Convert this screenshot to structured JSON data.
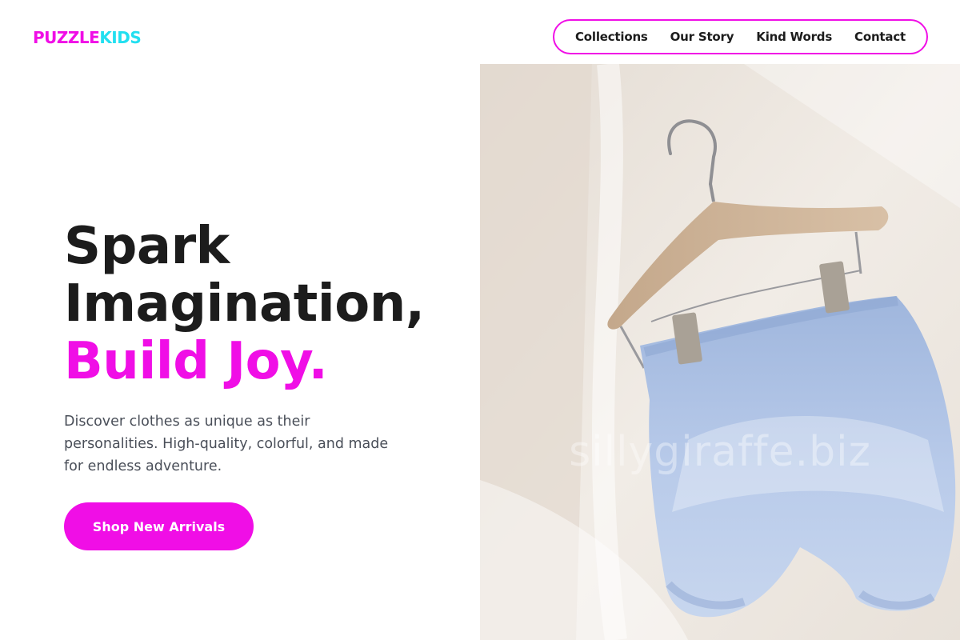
{
  "brand": {
    "part1": "PUZZLE",
    "part2": "KIDS",
    "color1": "#f00ee6",
    "color2": "#22dff0"
  },
  "nav": {
    "items": [
      "Collections",
      "Our Story",
      "Kind Words",
      "Contact"
    ],
    "border_color": "#f00ee6"
  },
  "hero": {
    "line1": "Spark",
    "line2": "Imagination,",
    "line3": "Build Joy.",
    "description": "Discover clothes as unique as their personalities. High-quality, colorful, and made for endless adventure.",
    "cta_label": "Shop New Arrivals",
    "accent_color": "#f00ee6"
  },
  "image": {
    "subject": "light blue baby bloomer shorts on wooden hanger",
    "watermark": "sillygiraffe.biz"
  }
}
